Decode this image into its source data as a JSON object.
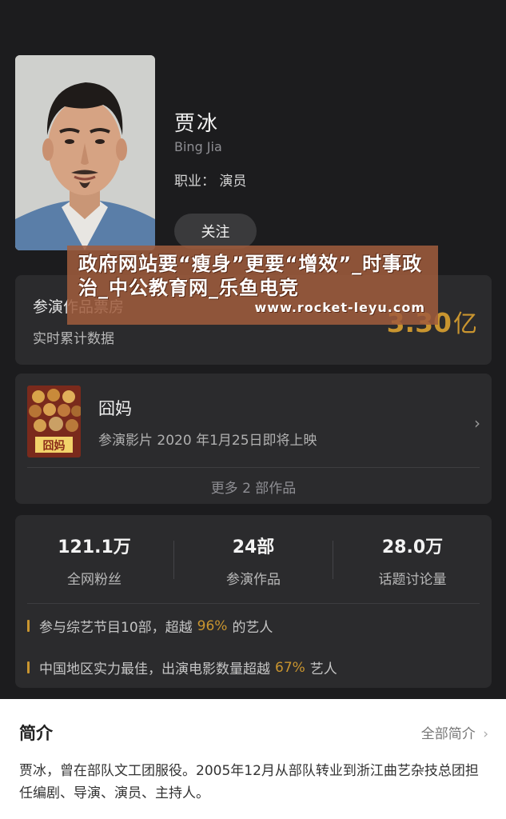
{
  "profile": {
    "name": "贾冰",
    "name_en": "Bing Jia",
    "job": "职业：  演员",
    "follow_label": "关注"
  },
  "box_office": {
    "title": "参演作品票房",
    "subtitle": "实时累计数据",
    "value": "3.30",
    "unit": "亿"
  },
  "works": {
    "title": "囧妈",
    "desc": "参演影片 2020 年1月25日即将上映",
    "more": "更多 2 部作品",
    "poster_text": "囧妈"
  },
  "stats": [
    {
      "value": "121.1万",
      "label": "全网粉丝"
    },
    {
      "value": "24部",
      "label": "参演作品"
    },
    {
      "value": "28.0万",
      "label": "话题讨论量"
    }
  ],
  "highlights": [
    {
      "before": "参与综艺节目10部，超越",
      "pct": "96%",
      "after": "的艺人"
    },
    {
      "before": "中国地区实力最佳，出演电影数量超越",
      "pct": "67%",
      "after": "艺人"
    }
  ],
  "intro": {
    "title": "简介",
    "all_label": "全部简介",
    "text": "贾冰，曾在部队文工团服役。2005年12月从部队转业到浙江曲艺杂技总团担任编剧、导演、演员、主持人。"
  },
  "watermark": {
    "line": "政府网站要“瘦身”更要“增效”_时事政治_中公教育网_乐鱼电竞",
    "url": "www.rocket-leyu.com"
  },
  "colors": {
    "accent": "#c9952f",
    "background": "#1c1c1e",
    "card": "#2b2b2d"
  }
}
